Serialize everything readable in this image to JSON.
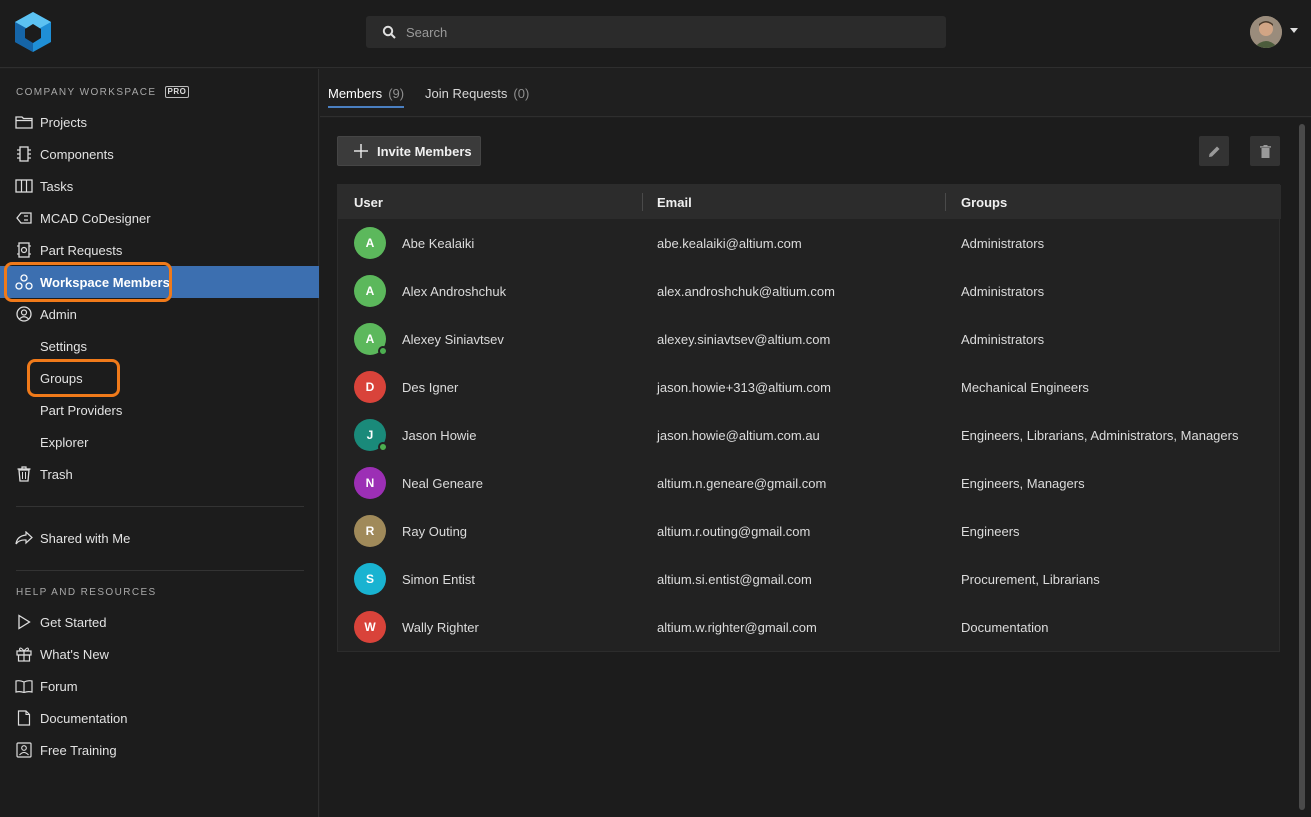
{
  "search": {
    "placeholder": "Search"
  },
  "sidebar": {
    "workspace_title": "COMPANY WORKSPACE",
    "pro_badge": "PRO",
    "items": [
      {
        "label": "Projects",
        "icon": "folder-icon"
      },
      {
        "label": "Components",
        "icon": "chip-icon"
      },
      {
        "label": "Tasks",
        "icon": "kanban-icon"
      },
      {
        "label": "MCAD CoDesigner",
        "icon": "mcad-icon"
      },
      {
        "label": "Part Requests",
        "icon": "part-request-icon"
      },
      {
        "label": "Workspace Members",
        "icon": "members-icon",
        "active": true
      },
      {
        "label": "Admin",
        "icon": "user-circle-icon"
      },
      {
        "label": "Settings"
      },
      {
        "label": "Groups"
      },
      {
        "label": "Part Providers"
      },
      {
        "label": "Explorer"
      },
      {
        "label": "Trash",
        "icon": "trash-icon"
      }
    ],
    "shared": {
      "label": "Shared with Me",
      "icon": "share-icon"
    },
    "help_title": "HELP AND RESOURCES",
    "help_items": [
      {
        "label": "Get Started",
        "icon": "play-icon"
      },
      {
        "label": "What's New",
        "icon": "gift-icon"
      },
      {
        "label": "Forum",
        "icon": "book-icon"
      },
      {
        "label": "Documentation",
        "icon": "document-icon"
      },
      {
        "label": "Free Training",
        "icon": "training-icon"
      }
    ]
  },
  "tabs": [
    {
      "label": "Members",
      "count": "(9)",
      "active": true
    },
    {
      "label": "Join Requests",
      "count": "(0)"
    }
  ],
  "toolbar": {
    "invite_label": "Invite Members"
  },
  "table": {
    "headers": [
      "User",
      "Email",
      "Groups"
    ],
    "rows": [
      {
        "initial": "A",
        "color": "#5cb85c",
        "online": false,
        "user": "Abe Kealaiki",
        "email": "abe.kealaiki@altium.com",
        "groups": "Administrators"
      },
      {
        "initial": "A",
        "color": "#5cb85c",
        "online": false,
        "user": "Alex Androshchuk",
        "email": "alex.androshchuk@altium.com",
        "groups": "Administrators"
      },
      {
        "initial": "A",
        "color": "#5cb85c",
        "online": true,
        "user": "Alexey Siniavtsev",
        "email": "alexey.siniavtsev@altium.com",
        "groups": "Administrators"
      },
      {
        "initial": "D",
        "color": "#d9433a",
        "online": false,
        "user": "Des Igner",
        "email": "jason.howie+313@altium.com",
        "groups": "Mechanical Engineers"
      },
      {
        "initial": "J",
        "color": "#1a8a7a",
        "online": true,
        "user": "Jason Howie",
        "email": "jason.howie@altium.com.au",
        "groups": "Engineers, Librarians, Administrators, Managers"
      },
      {
        "initial": "N",
        "color": "#9c2fb5",
        "online": false,
        "user": "Neal Geneare",
        "email": "altium.n.geneare@gmail.com",
        "groups": "Engineers, Managers"
      },
      {
        "initial": "R",
        "color": "#a08a5a",
        "online": false,
        "user": "Ray Outing",
        "email": "altium.r.outing@gmail.com",
        "groups": "Engineers"
      },
      {
        "initial": "S",
        "color": "#19b3d1",
        "online": false,
        "user": "Simon Entist",
        "email": "altium.si.entist@gmail.com",
        "groups": "Procurement, Librarians"
      },
      {
        "initial": "W",
        "color": "#d9433a",
        "online": false,
        "user": "Wally Righter",
        "email": "altium.w.righter@gmail.com",
        "groups": "Documentation"
      }
    ]
  },
  "colors": {
    "accent": "#3c6fb0",
    "highlight": "#f07a1a",
    "online": "#4caf50"
  }
}
